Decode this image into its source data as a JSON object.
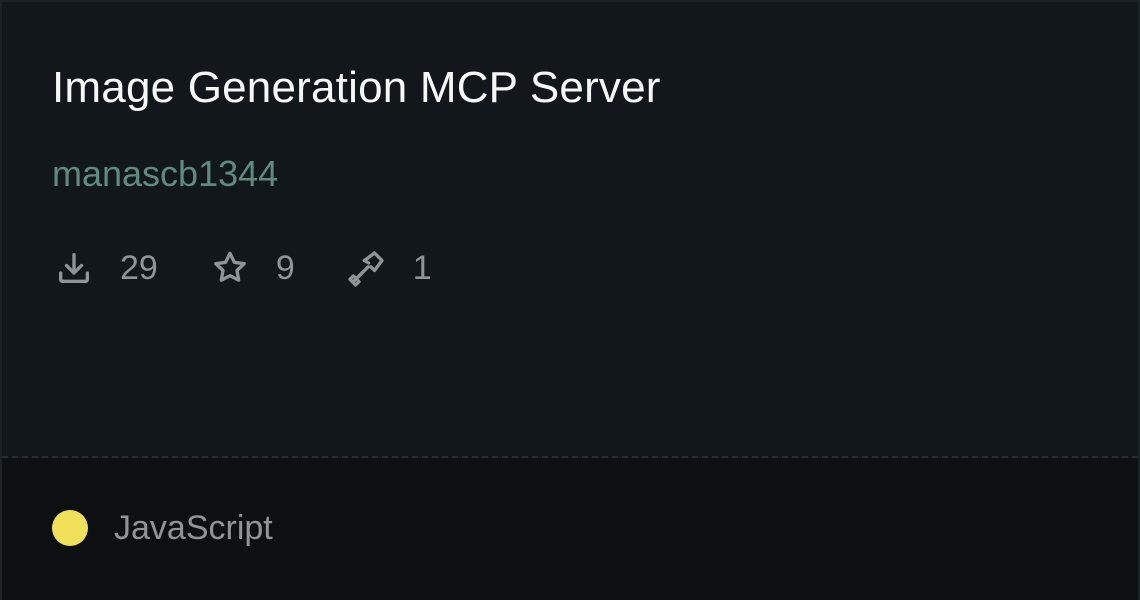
{
  "card": {
    "title": "Image Generation MCP Server",
    "author": "manascb1344",
    "stats": [
      {
        "icon": "download-icon",
        "value": "29"
      },
      {
        "icon": "star-icon",
        "value": "9"
      },
      {
        "icon": "hammer-icon",
        "value": "1"
      }
    ],
    "language": {
      "name": "JavaScript",
      "color": "#f1e05a"
    }
  }
}
